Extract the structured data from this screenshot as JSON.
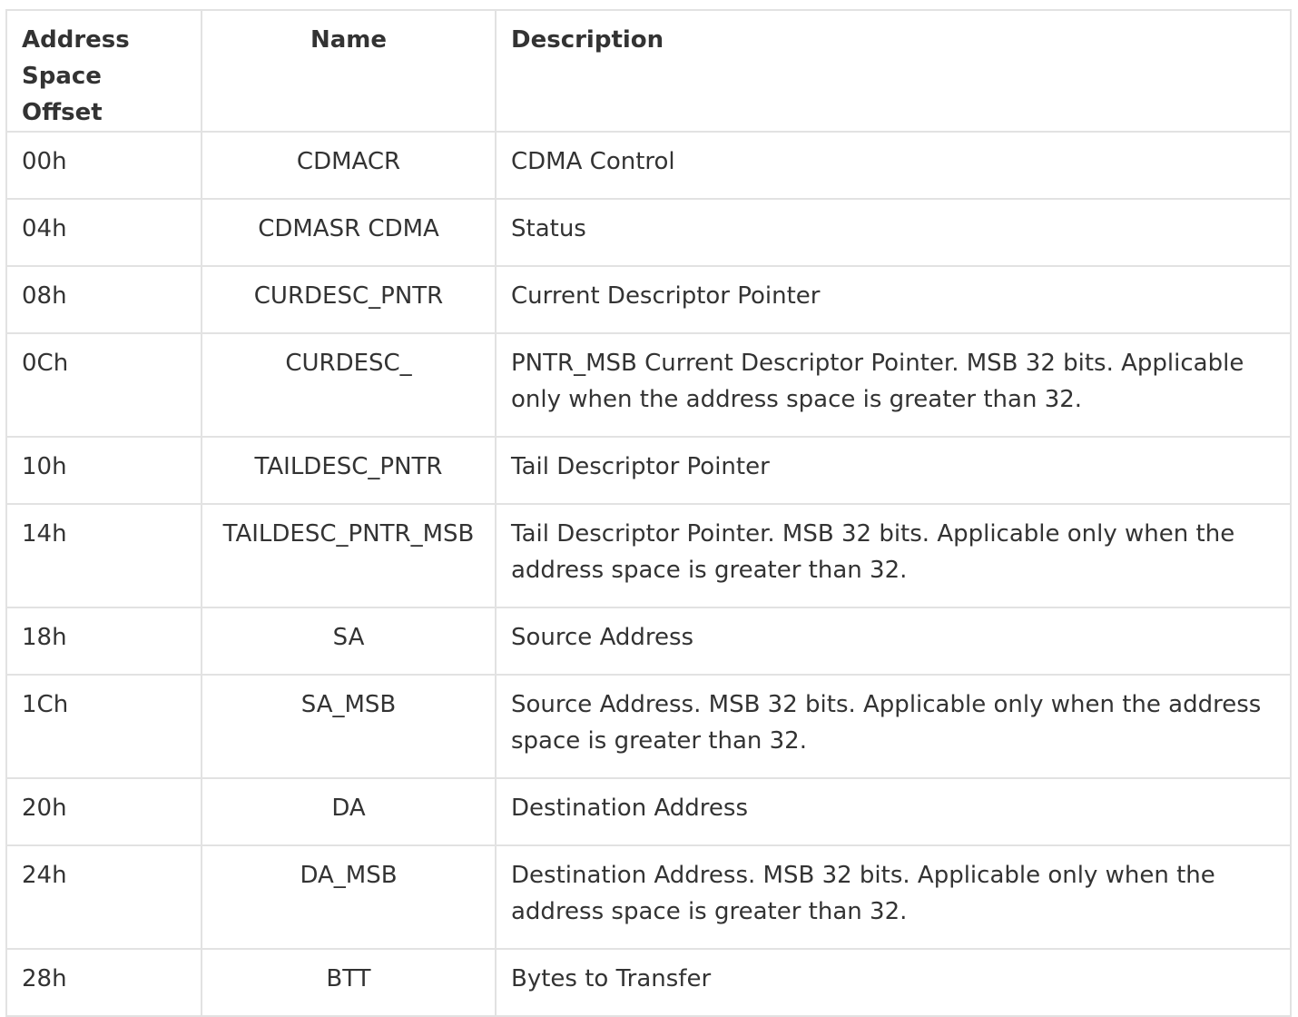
{
  "table": {
    "headers": {
      "offset": "Address Space Offset",
      "name": "Name",
      "description": "Description"
    },
    "rows": [
      {
        "offset": "00h",
        "name": "CDMACR",
        "description": "CDMA Control"
      },
      {
        "offset": "04h",
        "name": "CDMASR CDMA",
        "description": "Status"
      },
      {
        "offset": "08h",
        "name": "CURDESC_PNTR",
        "description": "Current Descriptor Pointer"
      },
      {
        "offset": "0Ch",
        "name": "CURDESC_",
        "description": "PNTR_MSB Current Descriptor Pointer. MSB 32 bits. Applicable only when the address space is greater than 32."
      },
      {
        "offset": "10h",
        "name": "TAILDESC_PNTR",
        "description": "Tail Descriptor Pointer"
      },
      {
        "offset": "14h",
        "name": "TAILDESC_PNTR_MSB",
        "description": "Tail Descriptor Pointer. MSB 32 bits. Applicable only when the address space is greater than 32."
      },
      {
        "offset": "18h",
        "name": "SA",
        "description": "Source Address"
      },
      {
        "offset": "1Ch",
        "name": "SA_MSB",
        "description": "Source Address. MSB 32 bits. Applicable only when the address space is greater than 32."
      },
      {
        "offset": "20h",
        "name": "DA",
        "description": "Destination Address"
      },
      {
        "offset": "24h",
        "name": "DA_MSB",
        "description": "Destination Address. MSB 32 bits. Applicable only when the address space is greater than 32."
      },
      {
        "offset": "28h",
        "name": "BTT",
        "description": "Bytes to Transfer"
      }
    ]
  }
}
